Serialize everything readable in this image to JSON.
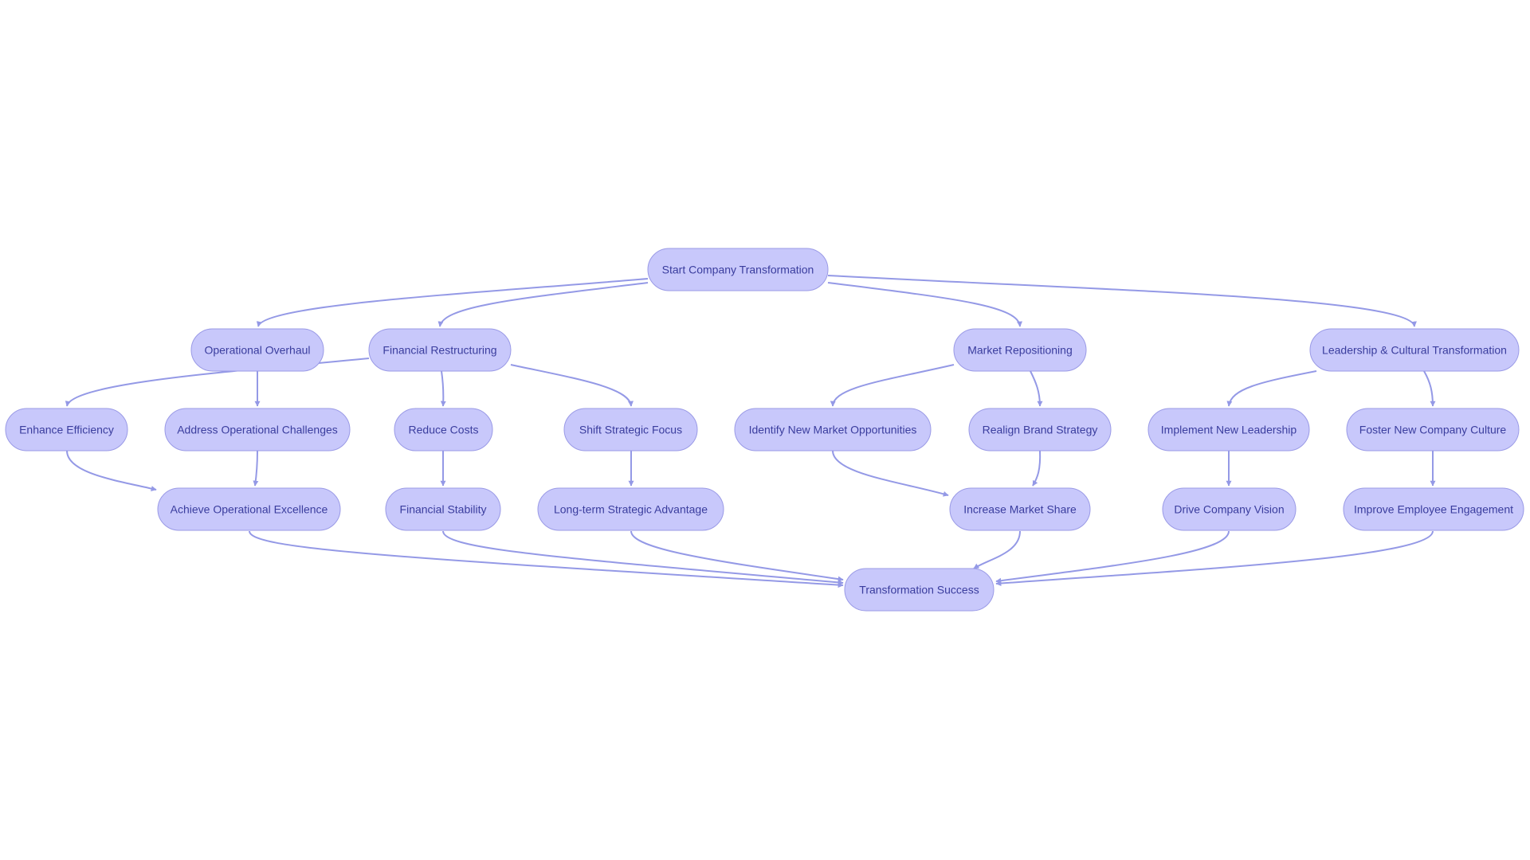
{
  "diagram": {
    "type": "flowchart",
    "direction": "top-down",
    "colors": {
      "node_fill": "#c8c8fb",
      "node_border": "#9a9ae6",
      "node_text": "#3a3d9e",
      "edge": "#9499e6",
      "background": "#ffffff"
    },
    "nodes": [
      {
        "id": "start",
        "label": "Start Company Transformation"
      },
      {
        "id": "opov",
        "label": "Operational Overhaul"
      },
      {
        "id": "finres",
        "label": "Financial Restructuring"
      },
      {
        "id": "mktrep",
        "label": "Market Repositioning"
      },
      {
        "id": "lead",
        "label": "Leadership & Cultural Transformation"
      },
      {
        "id": "enheff",
        "label": "Enhance Efficiency"
      },
      {
        "id": "addrops",
        "label": "Address Operational Challenges"
      },
      {
        "id": "redcost",
        "label": "Reduce Costs"
      },
      {
        "id": "shift",
        "label": "Shift Strategic Focus"
      },
      {
        "id": "ident",
        "label": "Identify New Market Opportunities"
      },
      {
        "id": "realign",
        "label": "Realign Brand Strategy"
      },
      {
        "id": "implead",
        "label": "Implement New Leadership"
      },
      {
        "id": "foster",
        "label": "Foster New Company Culture"
      },
      {
        "id": "achieve",
        "label": "Achieve Operational Excellence"
      },
      {
        "id": "finstab",
        "label": "Financial Stability"
      },
      {
        "id": "ltsa",
        "label": "Long-term Strategic Advantage"
      },
      {
        "id": "incmkt",
        "label": "Increase Market Share"
      },
      {
        "id": "drive",
        "label": "Drive Company Vision"
      },
      {
        "id": "improve",
        "label": "Improve Employee Engagement"
      },
      {
        "id": "success",
        "label": "Transformation Success"
      }
    ],
    "edges": [
      {
        "from": "start",
        "to": "opov"
      },
      {
        "from": "start",
        "to": "finres"
      },
      {
        "from": "start",
        "to": "mktrep"
      },
      {
        "from": "start",
        "to": "lead"
      },
      {
        "from": "finres",
        "to": "enheff"
      },
      {
        "from": "opov",
        "to": "addrops"
      },
      {
        "from": "finres",
        "to": "redcost"
      },
      {
        "from": "finres",
        "to": "shift"
      },
      {
        "from": "mktrep",
        "to": "ident"
      },
      {
        "from": "mktrep",
        "to": "realign"
      },
      {
        "from": "lead",
        "to": "implead"
      },
      {
        "from": "lead",
        "to": "foster"
      },
      {
        "from": "enheff",
        "to": "achieve"
      },
      {
        "from": "addrops",
        "to": "achieve"
      },
      {
        "from": "redcost",
        "to": "finstab"
      },
      {
        "from": "shift",
        "to": "ltsa"
      },
      {
        "from": "ident",
        "to": "incmkt"
      },
      {
        "from": "realign",
        "to": "incmkt"
      },
      {
        "from": "implead",
        "to": "drive"
      },
      {
        "from": "foster",
        "to": "improve"
      },
      {
        "from": "achieve",
        "to": "success"
      },
      {
        "from": "finstab",
        "to": "success"
      },
      {
        "from": "ltsa",
        "to": "success"
      },
      {
        "from": "incmkt",
        "to": "success"
      },
      {
        "from": "drive",
        "to": "success"
      },
      {
        "from": "improve",
        "to": "success"
      }
    ]
  }
}
